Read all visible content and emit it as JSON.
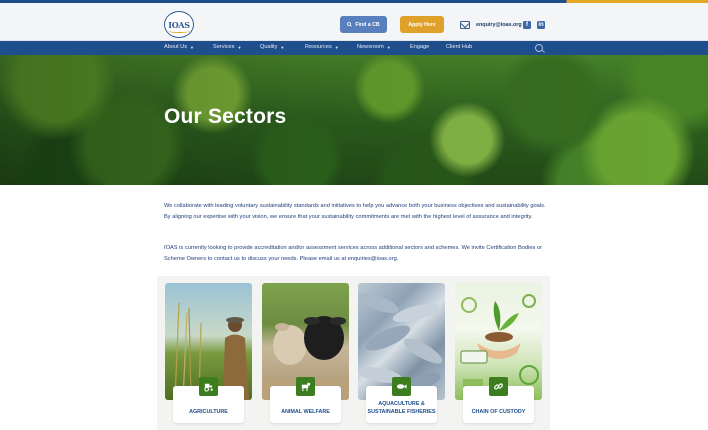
{
  "header": {
    "logo_text": "IOAS",
    "find_cb_label": "Find a CB",
    "apply_label": "Apply Here",
    "email": "enquiry@ioas.org",
    "social": [
      "facebook-icon",
      "linkedin-icon"
    ]
  },
  "nav": {
    "items": [
      {
        "label": "About Us",
        "dropdown": true
      },
      {
        "label": "Services",
        "dropdown": true
      },
      {
        "label": "Quality",
        "dropdown": true
      },
      {
        "label": "Resources",
        "dropdown": true
      },
      {
        "label": "Newsroom",
        "dropdown": true
      },
      {
        "label": "Engage",
        "dropdown": false
      },
      {
        "label": "Client Hub",
        "dropdown": false
      }
    ]
  },
  "hero": {
    "title": "Our Sectors"
  },
  "intro": {
    "p1": "We collaborate with leading voluntary sustainability standards and initiatives to help you advance both your business objectives and sustainability goals. By aligning our expertise with your vision, we ensure that your sustainability commitments are met with the highest level of assurance and integrity.",
    "p2": "IOAS is currently looking to provide accreditation and/or assessment services across additional sectors and schemes.  We invite Certification Bodies or Scheme Owners to contact us to discuss your needs.  Please email us at enquiries@ioas.org."
  },
  "sectors": [
    {
      "label": "AGRICULTURE",
      "icon": "tractor-icon"
    },
    {
      "label": "ANIMAL WELFARE",
      "icon": "cow-icon"
    },
    {
      "label": "AQUACULTURE & SUSTAINABLE FISHERIES",
      "icon": "fish-icon"
    },
    {
      "label": "CHAIN OF CUSTODY",
      "icon": "chain-link-icon"
    }
  ],
  "colors": {
    "brand_blue": "#1f4e8c",
    "accent_gold": "#e0a12a",
    "find_blue": "#5a7fbf",
    "sector_green": "#3c7d1f"
  }
}
